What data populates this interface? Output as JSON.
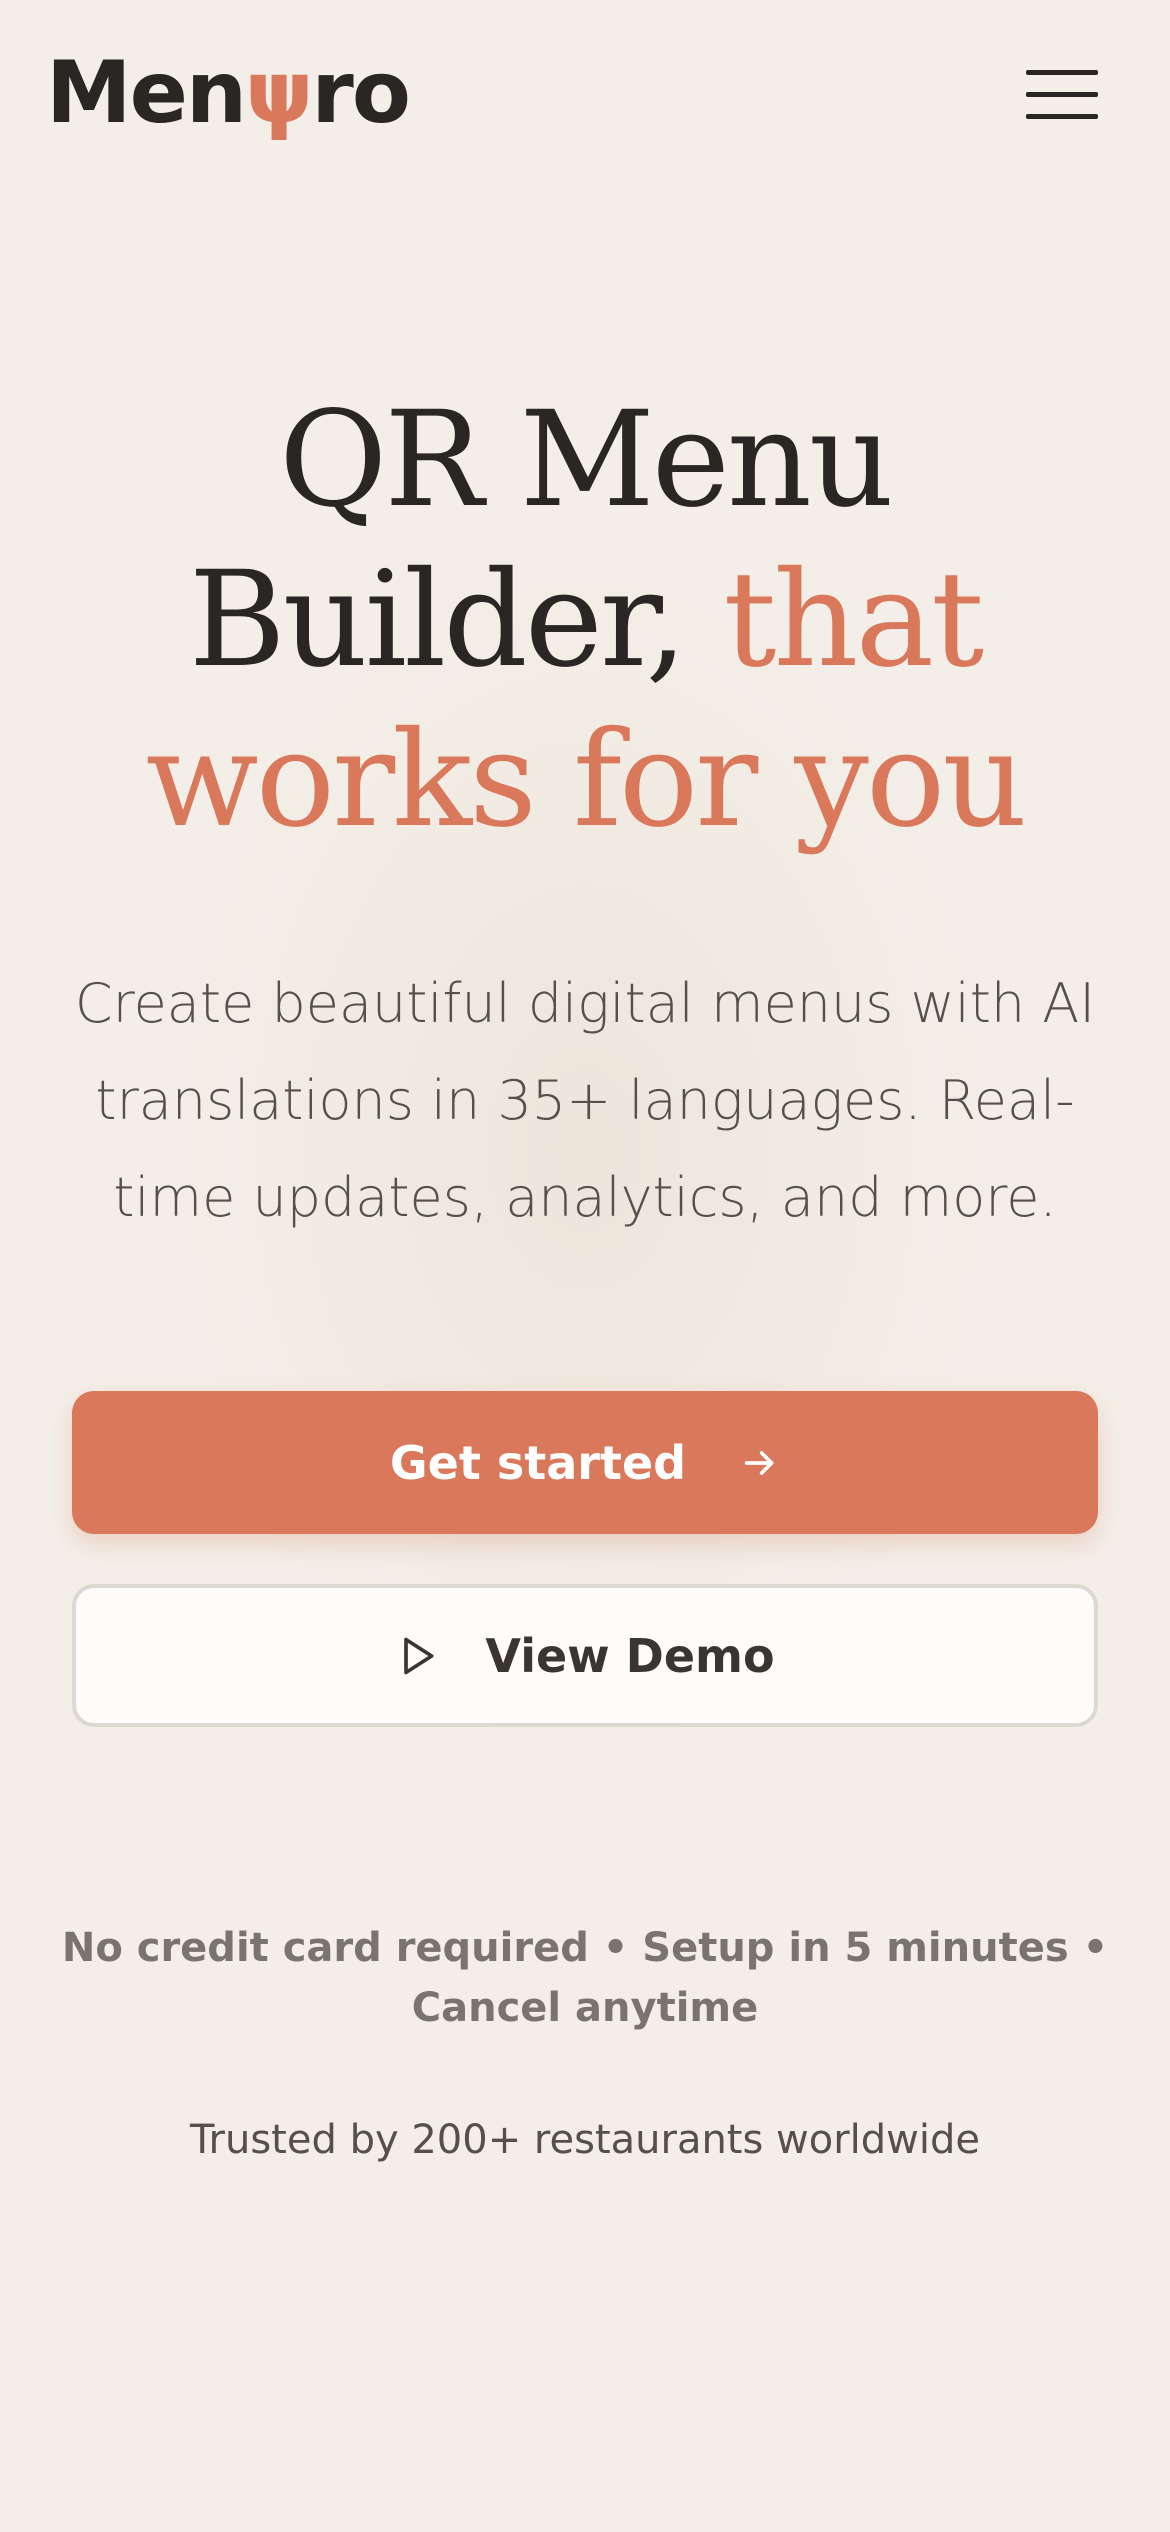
{
  "header": {
    "logo": {
      "part1": "Men",
      "part2": "ψ",
      "part3": "ro"
    },
    "menu_icon": "hamburger-menu-icon"
  },
  "hero": {
    "title_line1": "QR Menu",
    "title_line2_main": "Builder, ",
    "title_line2_accent": "that",
    "title_line3_accent": "works for you",
    "subtitle": "Create beautiful digital menus with AI translations in 35+ languages. Real-time updates, analytics, and more."
  },
  "cta": {
    "primary_label": "Get started",
    "primary_icon": "arrow-right-icon",
    "secondary_label": "View Demo",
    "secondary_icon": "play-icon"
  },
  "footer": {
    "note": "No credit card required • Setup in 5 minutes • Cancel anytime",
    "trusted": "Trusted by 200+ restaurants worldwide"
  },
  "colors": {
    "background": "#f3efe8",
    "accent": "#d9785a",
    "text": "#2a2623",
    "muted": "#7a746e"
  }
}
